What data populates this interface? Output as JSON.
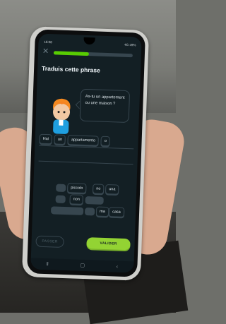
{
  "status_bar": {
    "time": "16:08",
    "right": "4G 49%"
  },
  "app": {
    "progress_fraction": 0.45,
    "close_icon": "close-icon",
    "title": "Traduis cette phrase",
    "bubble_text": "As-tu un appartement ou une maison ?",
    "answer_tiles": [
      "Hai",
      "un",
      "appartamento",
      "o"
    ],
    "word_bank": [
      "piccolo",
      "no",
      "una",
      "non",
      "ma",
      "casa"
    ],
    "skip_label": "PASSER",
    "check_label": "VALIDER"
  },
  "nav_icons": [
    "menu-icon",
    "home-icon",
    "back-icon"
  ],
  "colors": {
    "screen_bg": "#131f24",
    "accent_green": "#58cc02",
    "button_green": "#93d333",
    "tile_border": "#37464f"
  }
}
